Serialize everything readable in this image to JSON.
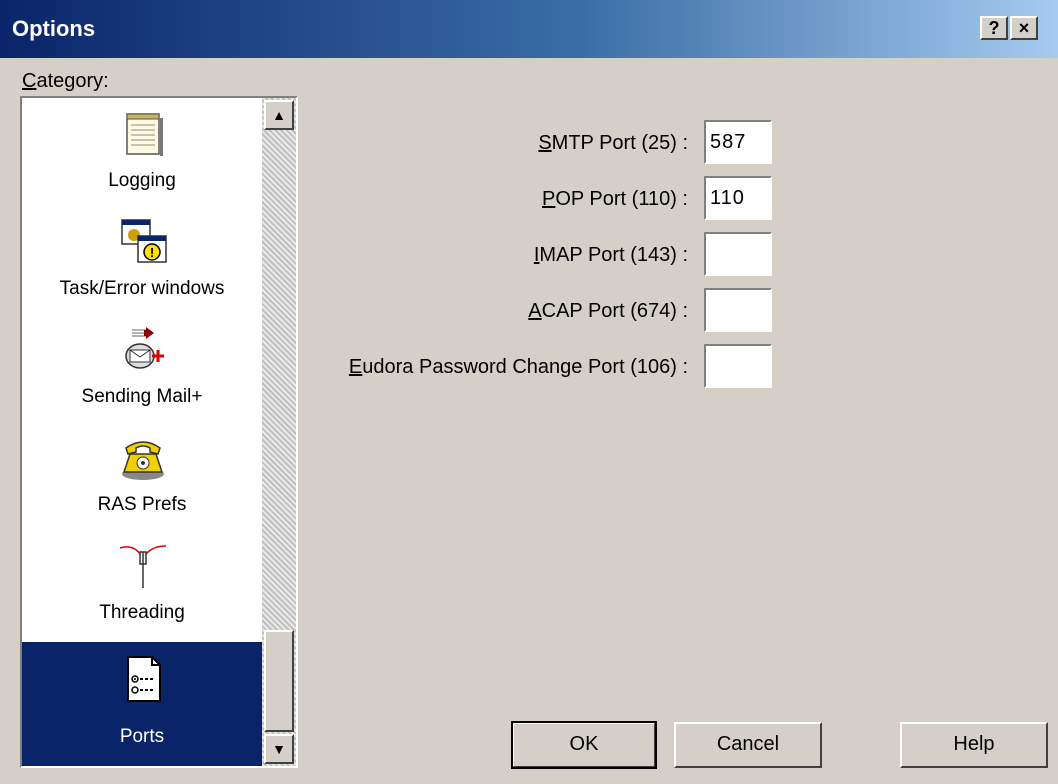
{
  "window": {
    "title": "Options",
    "help_button": "?",
    "close_button": "×"
  },
  "category": {
    "label_mnemonic": "C",
    "label_rest": "ategory:",
    "items": [
      {
        "label": "Logging",
        "icon": "notepad-icon"
      },
      {
        "label": "Task/Error windows",
        "icon": "task-error-windows-icon"
      },
      {
        "label": "Sending Mail+",
        "icon": "sending-mail-icon"
      },
      {
        "label": "RAS Prefs",
        "icon": "telephone-icon"
      },
      {
        "label": "Threading",
        "icon": "threading-icon"
      },
      {
        "label": "Ports",
        "icon": "ports-document-icon",
        "selected": true
      }
    ]
  },
  "ports": [
    {
      "mnemonic": "S",
      "rest": "MTP Port (25) :",
      "value": "587"
    },
    {
      "mnemonic": "P",
      "rest": "OP Port (110) :",
      "value": "110"
    },
    {
      "mnemonic": "I",
      "rest": "MAP Port (143) :",
      "value": ""
    },
    {
      "mnemonic": "A",
      "rest": "CAP Port (674) :",
      "value": ""
    },
    {
      "mnemonic": "E",
      "rest": "udora Password Change Port (106) :",
      "value": ""
    }
  ],
  "buttons": {
    "ok": "OK",
    "cancel": "Cancel",
    "help": "Help"
  },
  "colors": {
    "selection": "#0a246a",
    "dialog_face": "#d4d0c8"
  }
}
